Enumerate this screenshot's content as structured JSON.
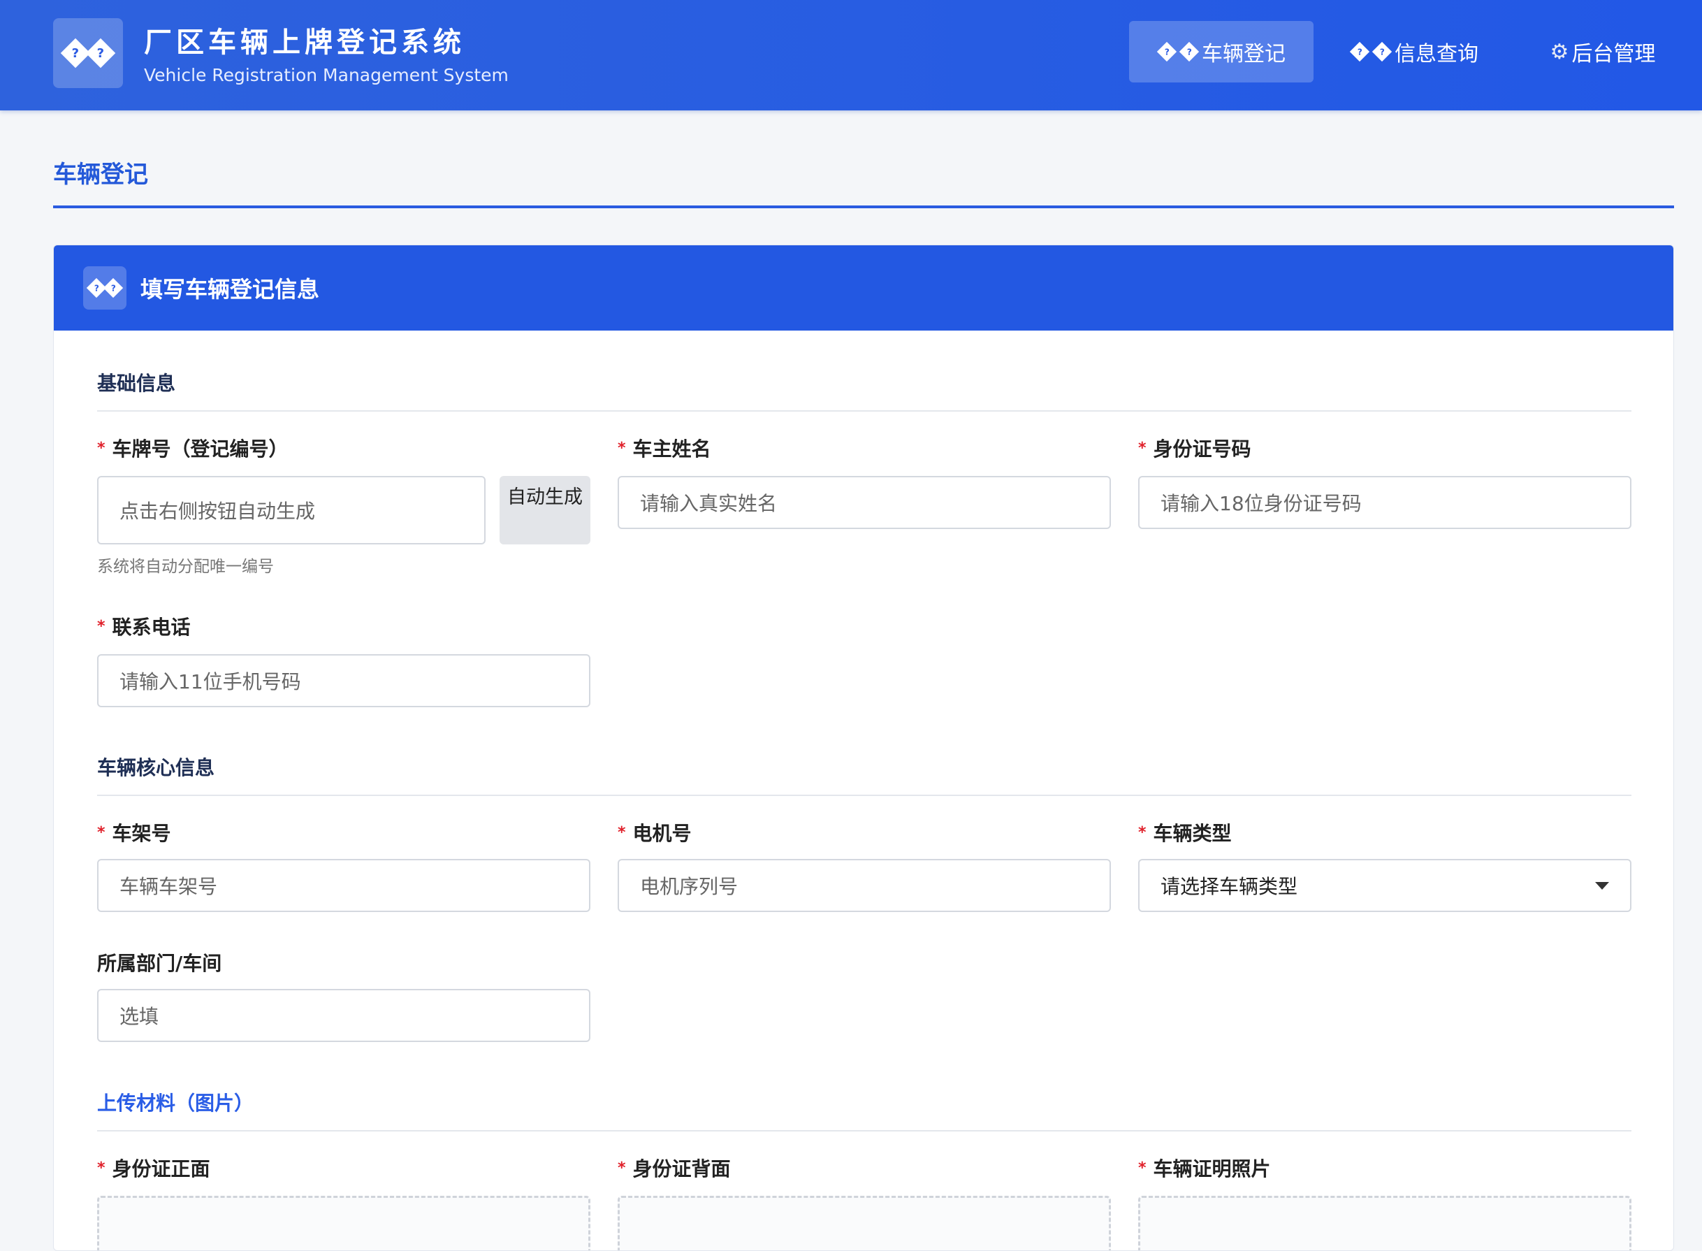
{
  "header": {
    "title": "厂区车辆上牌登记系统",
    "subtitle": "Vehicle Registration Management System",
    "logo_glyph": "?",
    "nav": [
      {
        "label": "车辆登记",
        "icon": "diamond-question-icon",
        "active": true
      },
      {
        "label": "信息查询",
        "icon": "diamond-question-icon",
        "active": false
      },
      {
        "label": "后台管理",
        "icon": "gear-icon",
        "active": false
      }
    ]
  },
  "page": {
    "title": "车辆登记"
  },
  "card": {
    "title": "填写车辆登记信息",
    "sections": {
      "basic": "基础信息",
      "vehicle": "车辆核心信息",
      "upload": "上传材料（图片）"
    },
    "fields": {
      "plate": {
        "label": "车牌号（登记编号）",
        "placeholder": "点击右侧按钮自动生成",
        "button": "自动生成",
        "hint": "系统将自动分配唯一编号"
      },
      "owner": {
        "label": "车主姓名",
        "placeholder": "请输入真实姓名"
      },
      "id_number": {
        "label": "身份证号码",
        "placeholder": "请输入18位身份证号码"
      },
      "phone": {
        "label": "联系电话",
        "placeholder": "请输入11位手机号码"
      },
      "frame": {
        "label": "车架号",
        "placeholder": "车辆车架号"
      },
      "motor": {
        "label": "电机号",
        "placeholder": "电机序列号"
      },
      "type": {
        "label": "车辆类型",
        "selected": "请选择车辆类型"
      },
      "dept": {
        "label": "所属部门/车间",
        "placeholder": "选填"
      },
      "id_front": {
        "label": "身份证正面"
      },
      "id_back": {
        "label": "身份证背面"
      },
      "vehicle_photo": {
        "label": "车辆证明照片"
      }
    }
  },
  "colors": {
    "primary": "#2358e2",
    "required": "#e0212b",
    "page_bg": "#f4f6f9"
  }
}
